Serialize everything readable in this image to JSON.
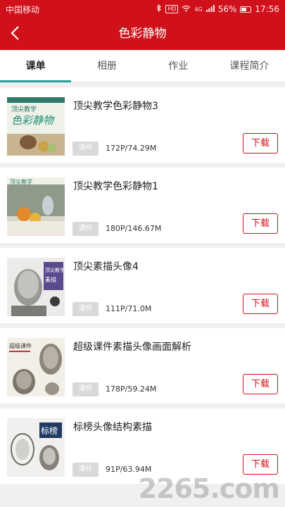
{
  "status_bar": {
    "carrier": "中国移动",
    "signal_badge": "HD",
    "network": "4G",
    "battery_percent": "56%",
    "battery_level": 0.56,
    "time": "17:56",
    "icons": [
      "bluetooth-icon",
      "hd-icon",
      "wifi-icon",
      "signal-icon",
      "battery-icon"
    ]
  },
  "appbar": {
    "title": "色彩静物",
    "back_icon": "chevron-left-icon"
  },
  "tabs": [
    {
      "label": "课单",
      "active": true
    },
    {
      "label": "相册",
      "active": false
    },
    {
      "label": "作业",
      "active": false
    },
    {
      "label": "课程简介",
      "active": false
    }
  ],
  "colors": {
    "brand_red": "#d0111b",
    "tab_indicator": "#1aa39a",
    "tag_gray": "#d9d9d9"
  },
  "courses": [
    {
      "title": "顶尖教学色彩静物3",
      "tag": "课件",
      "size": "172P/74.29M",
      "action": "下载",
      "thumb_text": "顶尖教学 色彩静物"
    },
    {
      "title": "顶尖教学色彩静物1",
      "tag": "课件",
      "size": "180P/146.67M",
      "action": "下载",
      "thumb_text": "顶尖教学"
    },
    {
      "title": "顶尖素描头像4",
      "tag": "课件",
      "size": "111P/71.0M",
      "action": "下载",
      "thumb_text": "顶尖教学 素描头像"
    },
    {
      "title": "超级课件素描头像画面解析",
      "tag": "课件",
      "size": "178P/59.24M",
      "action": "下载",
      "thumb_text": "超级课件"
    },
    {
      "title": "标榜头像结构素描",
      "tag": "课件",
      "size": "91P/63.94M",
      "action": "下载",
      "thumb_text": "标榜"
    }
  ],
  "watermark": "2265.com"
}
